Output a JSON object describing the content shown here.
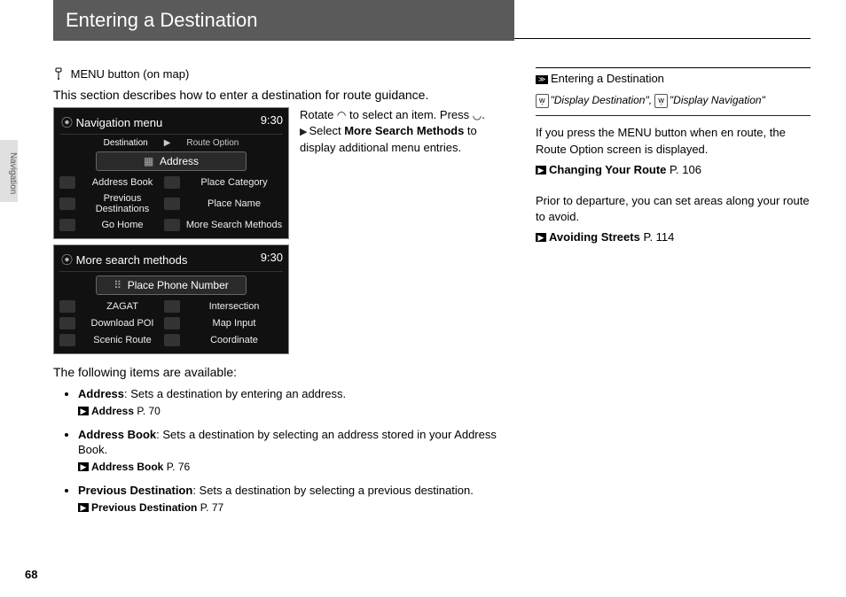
{
  "sideTab": "Navigation",
  "pageNumber": "68",
  "header": {
    "title": "Entering a Destination"
  },
  "crumb": {
    "menuBtn": "MENU button (on map)"
  },
  "intro": "This section describes how to enter a destination for route guidance.",
  "instruction": {
    "rotate_pre": "Rotate ",
    "rotate_mid": " to select an item. Press ",
    "rotate_post": ".",
    "bullet_pre": "Select ",
    "bullet_bold": "More Search Methods",
    "bullet_post": " to display additional menu entries."
  },
  "screen1": {
    "title": "Navigation menu",
    "clock": "9:30",
    "tab1": "Destination",
    "tab2": "Route Option",
    "main": "Address",
    "cells": {
      "c1": "Address Book",
      "c2": "Place Category",
      "c3": "Previous Destinations",
      "c4": "Place Name",
      "c5": "Go Home",
      "c6": "More Search Methods"
    }
  },
  "screen2": {
    "title": "More search methods",
    "clock": "9:30",
    "main": "Place Phone Number",
    "cells": {
      "c1": "ZAGAT",
      "c2": "Intersection",
      "c3": "Download POI",
      "c4": "Map Input",
      "c5": "Scenic Route",
      "c6": "Coordinate"
    }
  },
  "availLabel": "The following items are available:",
  "items": [
    {
      "name": "Address",
      "desc": ": Sets a destination by entering an address.",
      "linkText": "Address",
      "linkPage": "P. 70"
    },
    {
      "name": "Address Book",
      "desc": ": Sets a destination by selecting an address stored in your Address Book.",
      "linkText": "Address Book",
      "linkPage": "P. 76"
    },
    {
      "name": "Previous Destination",
      "desc": ": Sets a destination by selecting a previous destination.",
      "linkText": "Previous Destination",
      "linkPage": "P. 77"
    }
  ],
  "side": {
    "heading": "Entering a Destination",
    "voice1": "\"Display Destination\"",
    "voiceSep": ", ",
    "voice2": "\"Display Navigation\"",
    "para1": "If you press the MENU button when en route, the Route Option screen is displayed.",
    "link1Text": "Changing Your Route",
    "link1Page": "P. 106",
    "para2": "Prior to departure, you can set areas along your route to avoid.",
    "link2Text": "Avoiding Streets",
    "link2Page": "P. 114"
  }
}
